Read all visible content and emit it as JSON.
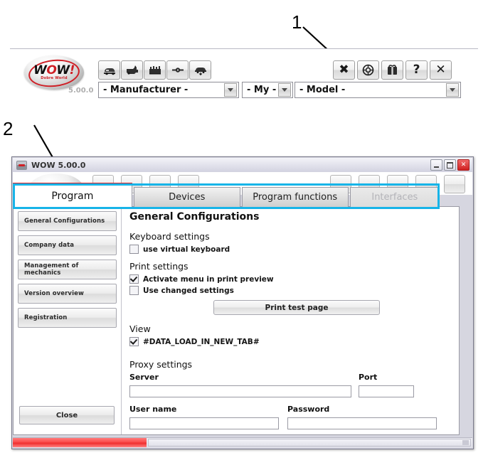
{
  "annotations": [
    {
      "number": "1",
      "target": "toolbar-tools-button"
    },
    {
      "number": "2",
      "target": "program-tab"
    }
  ],
  "top_app": {
    "logo": {
      "text_w": "W",
      "text_o": "O",
      "text_w2": "W",
      "text_excl": "!",
      "subtitle": "Dobre World",
      "version": "5.00.0"
    },
    "left_tools": [
      {
        "name": "car-icon",
        "title": "Car"
      },
      {
        "name": "engine-icon",
        "title": "Engine"
      },
      {
        "name": "truck-icon",
        "title": "Truck"
      },
      {
        "name": "shaft-icon",
        "title": "Shaft"
      },
      {
        "name": "car-download-icon",
        "title": "Vehicle download"
      }
    ],
    "right_tools": [
      {
        "name": "tools-icon",
        "glyph": "✖",
        "title": "Tools"
      },
      {
        "name": "settings-icon",
        "glyph": "©",
        "title": "Settings"
      },
      {
        "name": "package-icon",
        "glyph": "▣",
        "title": "Package"
      },
      {
        "name": "help-icon",
        "glyph": "?",
        "title": "Help"
      },
      {
        "name": "close-icon",
        "glyph": "✕",
        "title": "Close"
      }
    ],
    "selectors": [
      {
        "name": "manufacturer-select",
        "value": "- Manufacturer -"
      },
      {
        "name": "my-select",
        "value": "- My -"
      },
      {
        "name": "model-select",
        "value": "- Model -"
      }
    ]
  },
  "dialog": {
    "title": "WOW 5.00.0",
    "window_buttons": {
      "minimize": "minimize",
      "maximize": "maximize",
      "close": "✕"
    },
    "tabs": [
      {
        "label": "Program",
        "state": "active"
      },
      {
        "label": "Devices",
        "state": "normal"
      },
      {
        "label": "Program functions",
        "state": "normal"
      },
      {
        "label": "Interfaces",
        "state": "disabled"
      }
    ],
    "sidebar": {
      "items": [
        {
          "label": "General Configurations"
        },
        {
          "label": "Company data"
        },
        {
          "label": "Management of mechanics"
        },
        {
          "label": "Version overview"
        },
        {
          "label": "Registration"
        }
      ],
      "close_label": "Close"
    },
    "content": {
      "heading": "General Configurations",
      "sections": [
        {
          "title": "Keyboard settings",
          "checkboxes": [
            {
              "label": "use virtual keyboard",
              "checked": false
            }
          ]
        },
        {
          "title": "Print settings",
          "checkboxes": [
            {
              "label": "Activate menu in print preview",
              "checked": true
            },
            {
              "label": "Use changed settings",
              "checked": false
            }
          ],
          "button": "Print test page"
        },
        {
          "title": "View",
          "checkboxes": [
            {
              "label": "#DATA_LOAD_IN_NEW_TAB#",
              "checked": true
            }
          ]
        },
        {
          "title": "Proxy settings",
          "fields": [
            {
              "label": "Server",
              "value": "",
              "placeholder": ""
            },
            {
              "label": "Port",
              "value": "",
              "placeholder": ""
            },
            {
              "label": "User name",
              "value": "",
              "placeholder": ""
            },
            {
              "label": "Password",
              "value": "",
              "placeholder": ""
            }
          ]
        }
      ]
    },
    "status": {
      "progress_percent": 29
    }
  },
  "colors": {
    "accent_red": "#e01f26",
    "highlight_cyan": "#17b4e8",
    "titlebar": "#e2e2ec",
    "panel_bg": "#ffffff"
  }
}
